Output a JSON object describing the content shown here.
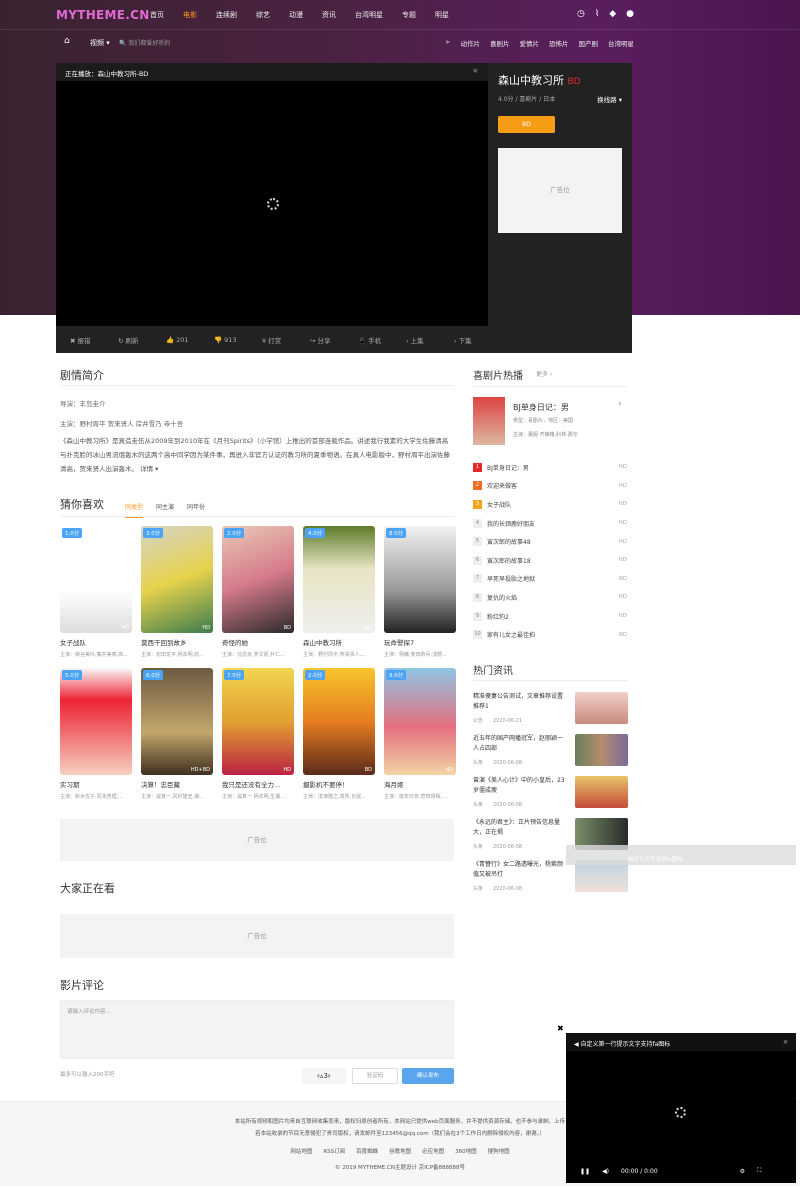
{
  "site": {
    "logo": "MYTHEME.CN",
    "nav": [
      "首页",
      "电影",
      "连续剧",
      "综艺",
      "动漫",
      "资讯",
      "台湾明星",
      "专题",
      "明星"
    ]
  },
  "subnav": {
    "category": "视频 ▾",
    "search_placeholder": "我们都爱好听的",
    "tags": [
      "动作片",
      "喜剧片",
      "爱情片",
      "恐怖片",
      "国产剧",
      "台湾明星"
    ]
  },
  "player": {
    "now_playing": "正在播放：森山中教习所-BD",
    "toolbar": [
      "✖ 报错",
      "↻ 刷新",
      "👍 201",
      "👎 913",
      "¥ 打赏",
      "↪ 分享",
      "📱 手机",
      "‹ 上集",
      "› 下集"
    ]
  },
  "movie": {
    "title": "森山中教习所",
    "quality": "BD",
    "meta": "4.0分 / 喜剧片 / 日本",
    "line_switch": "换线路 ▾",
    "play_button": "BD",
    "ad": "广告位"
  },
  "intro": {
    "heading": "剧情简介",
    "director": "导演：丰岛圭介",
    "actors": "主演：野村周平 贺来贤人 岸井雪乃 寺十吾",
    "text": "《森山中教习所》是真造圭伍从2009年到2010年在《月刊Spirits》（小学馆）上推出的首部连载作品。讲述我行我素的大学生佐藤清高与扑克脸的冰山男流氓轰木的这两个高中同学因为某件事，再进入非官方认证的教习所的夏季物语。在真人电影版中，野村周平出演佐藤清高，贺来贤人出演轰木。 详情 ▾"
  },
  "guess": {
    "heading": "猜你喜欢",
    "tabs": [
      "同类型",
      "同主演",
      "同年份"
    ]
  },
  "movies_row1": [
    {
      "title": "女子战队",
      "actors": "主演：柳谷美玲,藤井美菜,高...",
      "score": "1.0分",
      "hd": "HD",
      "bg": "linear-gradient(#fff,#fff 60%,#ddd)"
    },
    {
      "title": "莫西干回到故乡",
      "actors": "主演：松田龙平,柄本明,前...",
      "score": "3.0分",
      "hd": "HD",
      "bg": "linear-gradient(160deg,#d4d4c8,#e7d24c 50%,#3b7c4d)"
    },
    {
      "title": "奇怪的她",
      "actors": "主演：沈恩京,罗文姬,朴仁...",
      "score": "2.0分",
      "hd": "BD",
      "bg": "linear-gradient(160deg,#e8c9b4,#d67a8a 50%,#2a2a2a)"
    },
    {
      "title": "森山中教习所",
      "actors": "主演：野村周平,贺来贤人,...",
      "score": "4.0分",
      "hd": "BD",
      "bg": "linear-gradient(#5d7c2a,#e8e4c4 40%,#eee)"
    },
    {
      "title": "玩命警探7",
      "actors": "主演：杨曦,柴田恭兵,浅野...",
      "score": "8.0分",
      "hd": "",
      "bg": "linear-gradient(#f2f2f2,#999 60%,#222)"
    }
  ],
  "movies_row2": [
    {
      "title": "实习期",
      "actors": "主演：新木优子,冈本杏理,...",
      "score": "5.0分",
      "hd": "",
      "bg": "linear-gradient(#f8f8f8,#e23 30%,#f4d0c0)"
    },
    {
      "title": "决算！忠臣藏",
      "actors": "主演：堤真一,冈村隆史,濑...",
      "score": "6.0分",
      "hd": "HD+BD",
      "bg": "linear-gradient(#6c5a42,#c2a66c 60%,#403020)"
    },
    {
      "title": "我只是还没有全力...",
      "actors": "主演：堤真一,柄本明,生瀬...",
      "score": "7.0分",
      "hd": "HD",
      "bg": "linear-gradient(#f1d64f,#e2a030 50%,#b24)"
    },
    {
      "title": "摄影机不要停！",
      "actors": "主演：滨津隆之,真魚,长屋...",
      "score": "2.0分",
      "hd": "BD",
      "bg": "linear-gradient(#f6c52c,#e67d20 50%,#5a2a1a)"
    },
    {
      "title": "海月姬",
      "actors": "主演：能年玲奈,菅田将晖,...",
      "score": "9.0分",
      "hd": "HD",
      "bg": "linear-gradient(#8fc6e4,#e46f7f 55%,#f2d4a4)"
    }
  ],
  "ads": {
    "ad1": "广告位",
    "ad2": "广告位"
  },
  "watching": {
    "heading": "大家正在看"
  },
  "comments": {
    "heading": "影片评论",
    "placeholder": "请输入评论内容...",
    "hint": "最多可以输入200字符",
    "captcha": "ⲋⲁ3ⲋ",
    "captcha_placeholder": "验证码",
    "submit": "确认发布"
  },
  "hot": {
    "heading": "喜剧片热播",
    "more": "更多 ›",
    "featured": {
      "title": "BJ单身日记：男",
      "meta": "类型：喜剧片，地区：美国",
      "actors": "主演：蕾妮·齐薇格,科林·费尔"
    },
    "list": [
      {
        "n": "1",
        "t": "BJ单身日记：男",
        "q": "HD"
      },
      {
        "n": "2",
        "t": "欢迎来做客",
        "q": "HD"
      },
      {
        "n": "3",
        "t": "女子战队",
        "q": "HD"
      },
      {
        "n": "4",
        "t": "我的长颈鹿好朋友",
        "q": "HD"
      },
      {
        "n": "5",
        "t": "寅次郎的故事48",
        "q": "HD"
      },
      {
        "n": "6",
        "t": "寅次郎的故事18",
        "q": "HD"
      },
      {
        "n": "7",
        "t": "早死早投胎之地狱",
        "q": "BD"
      },
      {
        "n": "8",
        "t": "复仇的火焰",
        "q": "HD"
      },
      {
        "n": "9",
        "t": "粉红豹2",
        "q": "HD"
      },
      {
        "n": "10",
        "t": "家有儿女之最佳拍",
        "q": "BD"
      }
    ]
  },
  "news": {
    "heading": "热门资讯",
    "items": [
      {
        "t": "精准傻妻公告测试，文章推荐设置推荐1",
        "src": "公告",
        "d": "2020-06-21",
        "bg": "linear-gradient(#f2d0c8,#c98a7c)"
      },
      {
        "t": "近五年的国产网播冠军，赵丽颖一人占四部",
        "src": "头条",
        "d": "2020-06-08",
        "bg": "linear-gradient(90deg,#6a7f5a,#b48c6c,#7a6a9a)"
      },
      {
        "t": "曾演《美人心计》中的小皇后，23岁僵成瘦",
        "src": "头条",
        "d": "2020-06-08",
        "bg": "linear-gradient(#e7c46a,#c44b3a)"
      },
      {
        "t": "《永远的君主》：正片预告信息量大，正在揭",
        "src": "头条",
        "d": "2020-06-08",
        "bg": "linear-gradient(90deg,#7a8f6a,#2a2a2a)"
      },
      {
        "t": "《青簪行》女二路透曝光，杨紫颜值又被吊打",
        "src": "头条",
        "d": "2020-06-08",
        "bg": "linear-gradient(#bcd4e4,#f0e0d8)"
      }
    ]
  },
  "float_tip": "自定义文字支持fa图标",
  "mini_player": {
    "title": "◀ 自定义第一行提示文字支持fa图标",
    "time": "00:00 / 0:00",
    "close": "✖"
  },
  "footer": {
    "line1": "本站所有视频和图片均来自互联网收集而来，版权归原创者所有，本网站只提供web页面服务，并不提供资源存储，也不参与录制、上传",
    "line2": "若本站收录的节目无意侵犯了贵司版权，请发邮件至123456@qq.com（我们会在3个工作日内删除侵权内容，谢谢。）",
    "links": "网站地图　　RSS订阅　　百度蜘蛛　　谷歌地图　　必应地图　　360地图　　搜狗地图",
    "copyright": "© 2019 MYTHEME.CN主题设计 京ICP备888888号"
  }
}
